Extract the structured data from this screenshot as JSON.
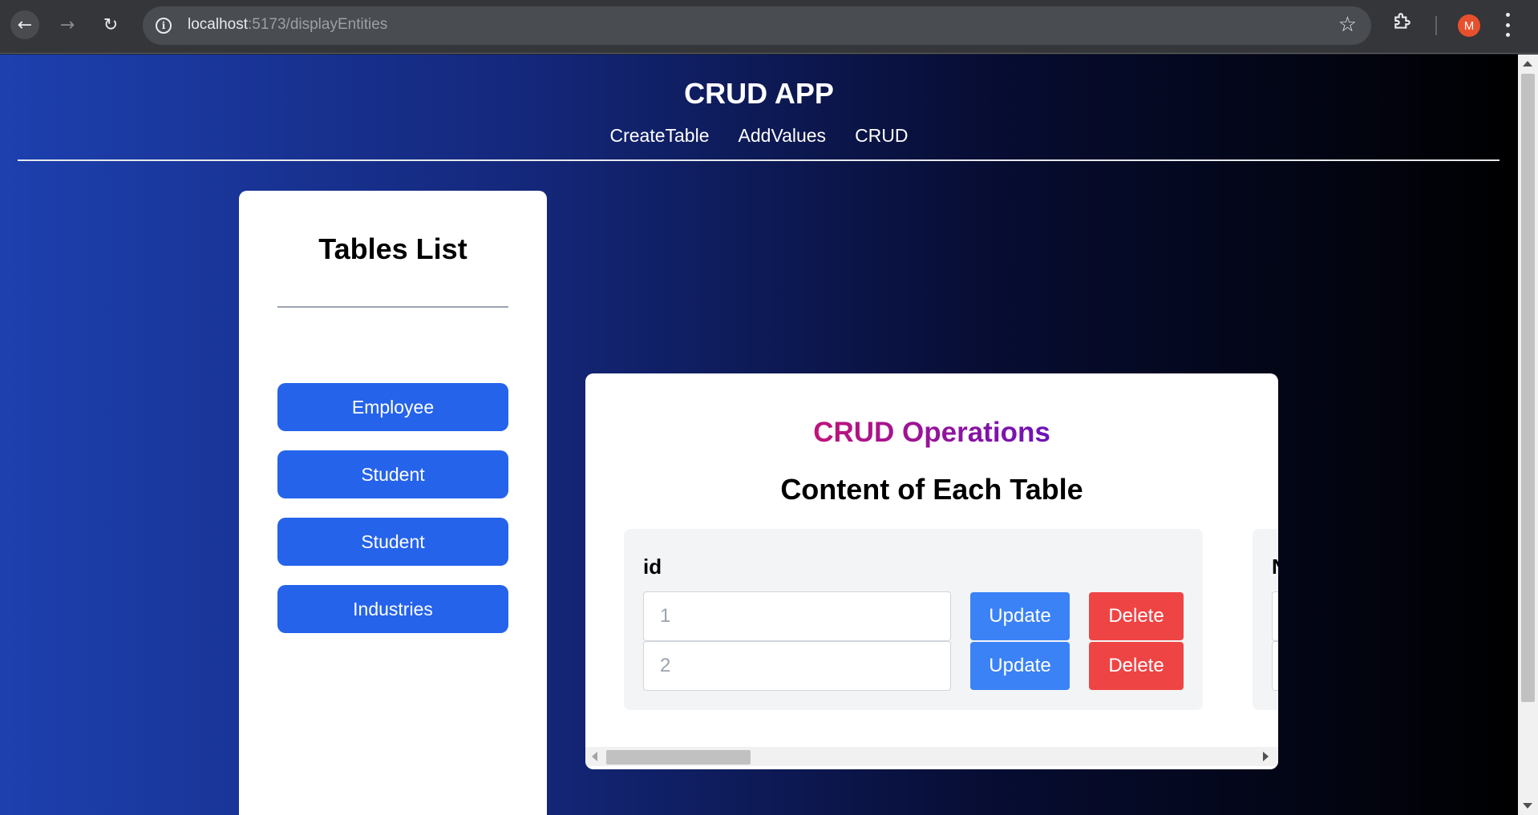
{
  "browser": {
    "url_host": "localhost",
    "url_path": ":5173/displayEntities",
    "avatar_letter": "M"
  },
  "app": {
    "title": "CRUD APP",
    "nav": [
      "CreateTable",
      "AddValues",
      "CRUD"
    ]
  },
  "sidebar": {
    "title": "Tables List",
    "tables": [
      "Employee",
      "Student",
      "Student",
      "Industries"
    ]
  },
  "crud": {
    "title": "CRUD Operations",
    "subtitle": "Content of Each Table",
    "columns": [
      {
        "label": "id",
        "rows": [
          {
            "placeholder": "1",
            "update": "Update",
            "delete": "Delete"
          },
          {
            "placeholder": "2",
            "update": "Update",
            "delete": "Delete"
          }
        ]
      },
      {
        "label": "N"
      }
    ]
  },
  "colors": {
    "primary_button": "#2563eb",
    "update_button": "#3b82f6",
    "delete_button": "#ef4444",
    "title_gradient_start": "#c0147a",
    "title_gradient_end": "#6d13b8"
  }
}
